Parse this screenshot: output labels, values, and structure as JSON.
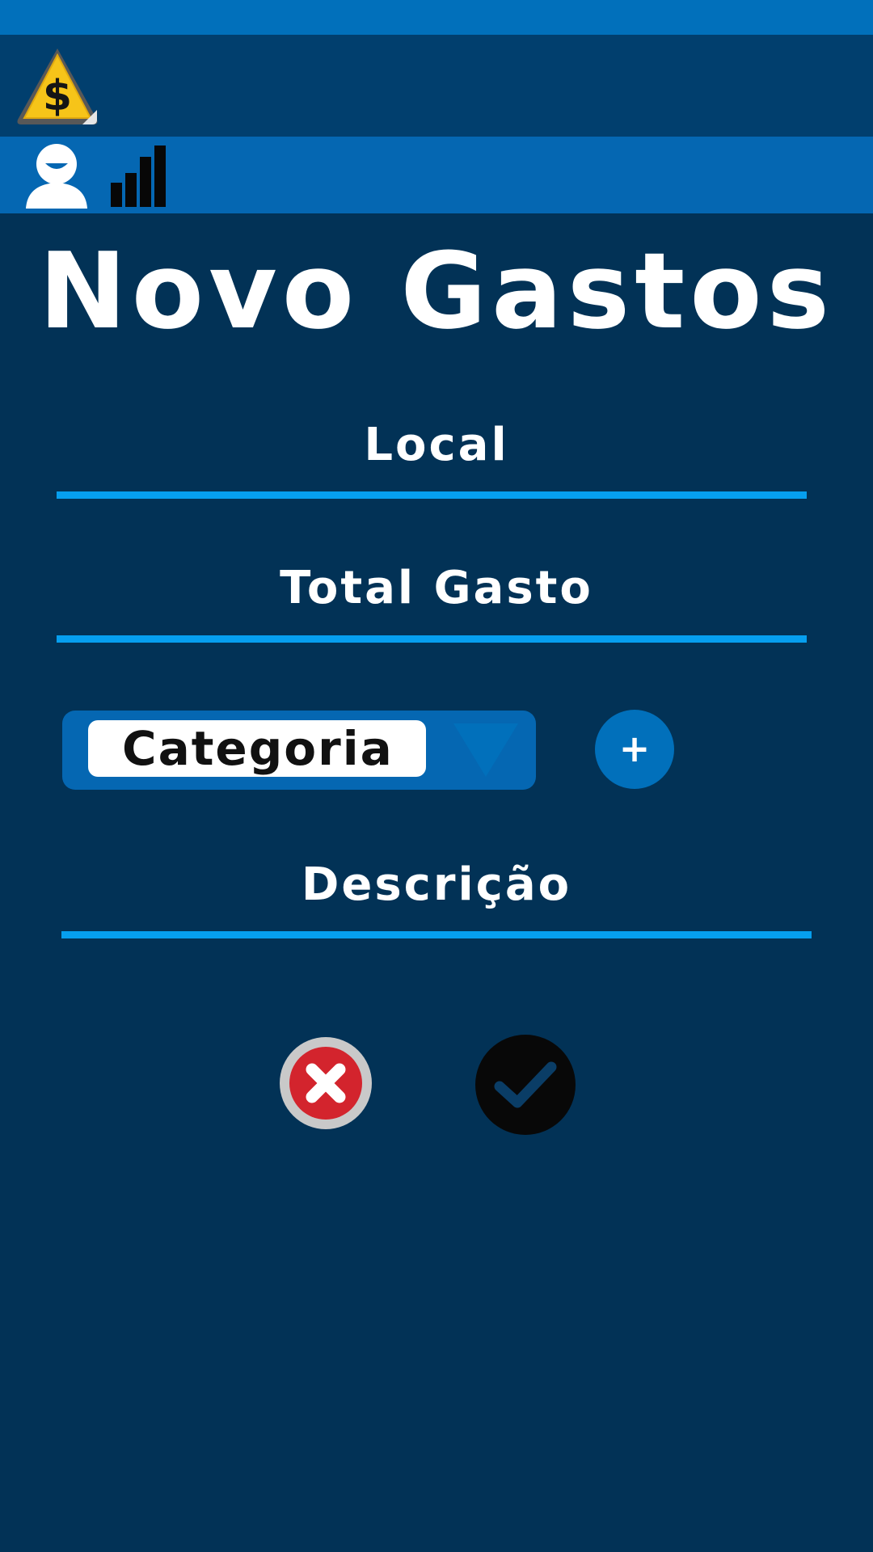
{
  "app": {
    "logo_icon": "dollar-warning-sign-icon"
  },
  "nav": {
    "user_icon": "user-icon",
    "stats_icon": "bar-chart-icon"
  },
  "page": {
    "title": "Novo Gastos"
  },
  "form": {
    "local_label": "Local",
    "local_value": "",
    "total_label": "Total Gasto",
    "total_value": "",
    "category_value": "Categoria",
    "category_arrow_icon": "triangle-down-icon",
    "add_category_label": "+",
    "description_label": "Descrição",
    "description_value": ""
  },
  "actions": {
    "cancel_icon": "close-icon",
    "confirm_icon": "check-icon"
  },
  "colors": {
    "background": "#023256",
    "top_strip": "#0170bb",
    "header": "#013f6e",
    "nav_bar": "#0567b2",
    "accent_line": "#069fef",
    "cancel_red": "#d3242d",
    "logo_yellow": "#f6c419"
  }
}
